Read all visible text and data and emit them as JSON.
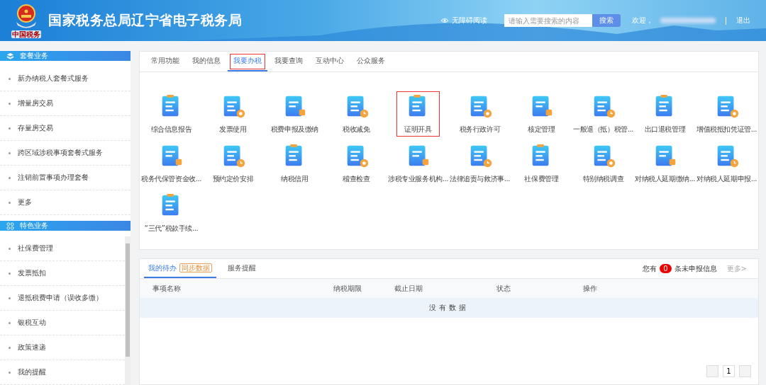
{
  "header": {
    "title": "国家税务总局辽宁省电子税务局",
    "emblem_caption": "中国税务",
    "accessibility_link": "无障碍阅读",
    "search": {
      "placeholder": "请输入需要搜索的内容",
      "button": "搜索"
    },
    "welcome": "欢迎，",
    "logout": "退出"
  },
  "sidebar": {
    "sections": [
      {
        "title": "套餐业务",
        "kind": "package",
        "items": [
          "新办纳税人套餐式服务",
          "增量房交易",
          "存量房交易",
          "跨区域涉税事项套餐式服务",
          "注销前置事项办理套餐",
          "更多"
        ]
      },
      {
        "title": "特色业务",
        "kind": "feature",
        "items": [
          "社保费管理",
          "发票抵扣",
          "退抵税费申请（误收多缴）",
          "银税互动",
          "政策速递",
          "我的提醒"
        ]
      }
    ]
  },
  "tabs": [
    {
      "label": "常用功能",
      "selected": false,
      "outlined": false
    },
    {
      "label": "我的信息",
      "selected": false,
      "outlined": false
    },
    {
      "label": "我要办税",
      "selected": true,
      "outlined": true
    },
    {
      "label": "我要查询",
      "selected": false,
      "outlined": false
    },
    {
      "label": "互动中心",
      "selected": false,
      "outlined": false
    },
    {
      "label": "公众服务",
      "selected": false,
      "outlined": false
    }
  ],
  "services": [
    {
      "label": "综合信息报告",
      "outlined": false
    },
    {
      "label": "发票使用",
      "outlined": false
    },
    {
      "label": "税费申报及缴纳",
      "outlined": false
    },
    {
      "label": "税收减免",
      "outlined": false
    },
    {
      "label": "证明开具",
      "outlined": true
    },
    {
      "label": "税务行政许可",
      "outlined": false
    },
    {
      "label": "核定管理",
      "outlined": false
    },
    {
      "label": "一般退（抵）税管...",
      "outlined": false
    },
    {
      "label": "出口退税管理",
      "outlined": false
    },
    {
      "label": "增值税抵扣凭证管...",
      "outlined": false
    },
    {
      "label": "税务代保管资金收...",
      "outlined": false
    },
    {
      "label": "预约定价安排",
      "outlined": false
    },
    {
      "label": "纳税信用",
      "outlined": false
    },
    {
      "label": "稽查检查",
      "outlined": false
    },
    {
      "label": "涉税专业服务机构...",
      "outlined": false
    },
    {
      "label": "法律追责与救济事...",
      "outlined": false
    },
    {
      "label": "社保费管理",
      "outlined": false
    },
    {
      "label": "特别纳税调查",
      "outlined": false
    },
    {
      "label": "对纳税人延期缴纳...",
      "outlined": false
    },
    {
      "label": "对纳税人延期申报...",
      "outlined": false
    },
    {
      "label": "“三代”税款手续...",
      "outlined": false
    }
  ],
  "todo": {
    "tabs": [
      {
        "label": "我的待办",
        "badge": "同步数据",
        "selected": true
      },
      {
        "label": "服务提醒",
        "selected": false
      }
    ],
    "notice": {
      "prefix": "您有",
      "count": "0",
      "suffix": "条未申报信息"
    },
    "more": "更多>",
    "table": {
      "columns": [
        "事项名称",
        "纳税期限",
        "截止日期",
        "状态",
        "操作"
      ],
      "empty": "没有数据"
    },
    "pagination": {
      "pages": [
        {
          "label": "1"
        }
      ]
    }
  }
}
